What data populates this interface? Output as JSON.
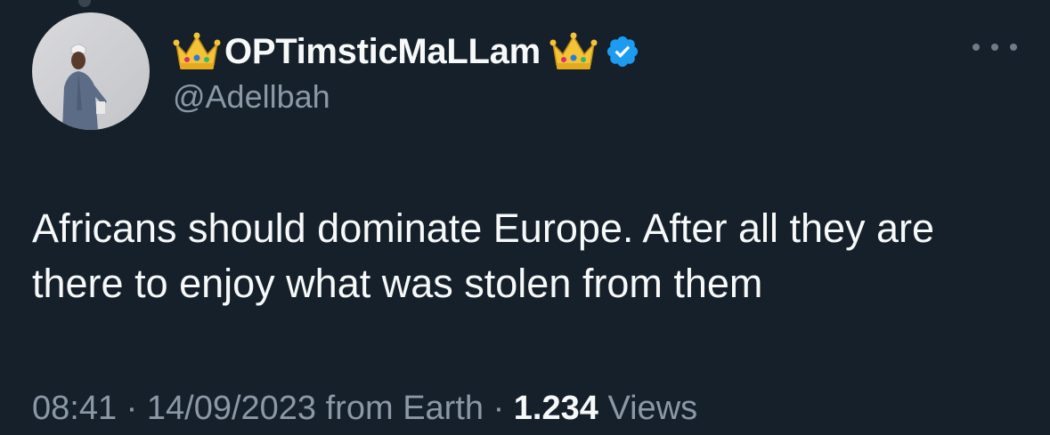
{
  "author": {
    "display_name": "OPTimsticMaLLam",
    "handle": "@Adellbah",
    "verified": true,
    "name_emoji": "crown-emoji"
  },
  "tweet": {
    "text": "Africans should dominate Europe. After all they are there to enjoy what was stolen from them",
    "time": "08:41",
    "date": "14/09/2023",
    "source_prefix": "from",
    "source": "Earth",
    "separator": "·",
    "views_count": "1.234",
    "views_label": "Views"
  },
  "icons": {
    "more": "more-dots-icon",
    "verified": "verified-badge-icon"
  },
  "colors": {
    "background": "#15202b",
    "primary_text": "#f7f9f9",
    "secondary_text": "#8b98a5",
    "verified_blue": "#1d9bf0"
  }
}
